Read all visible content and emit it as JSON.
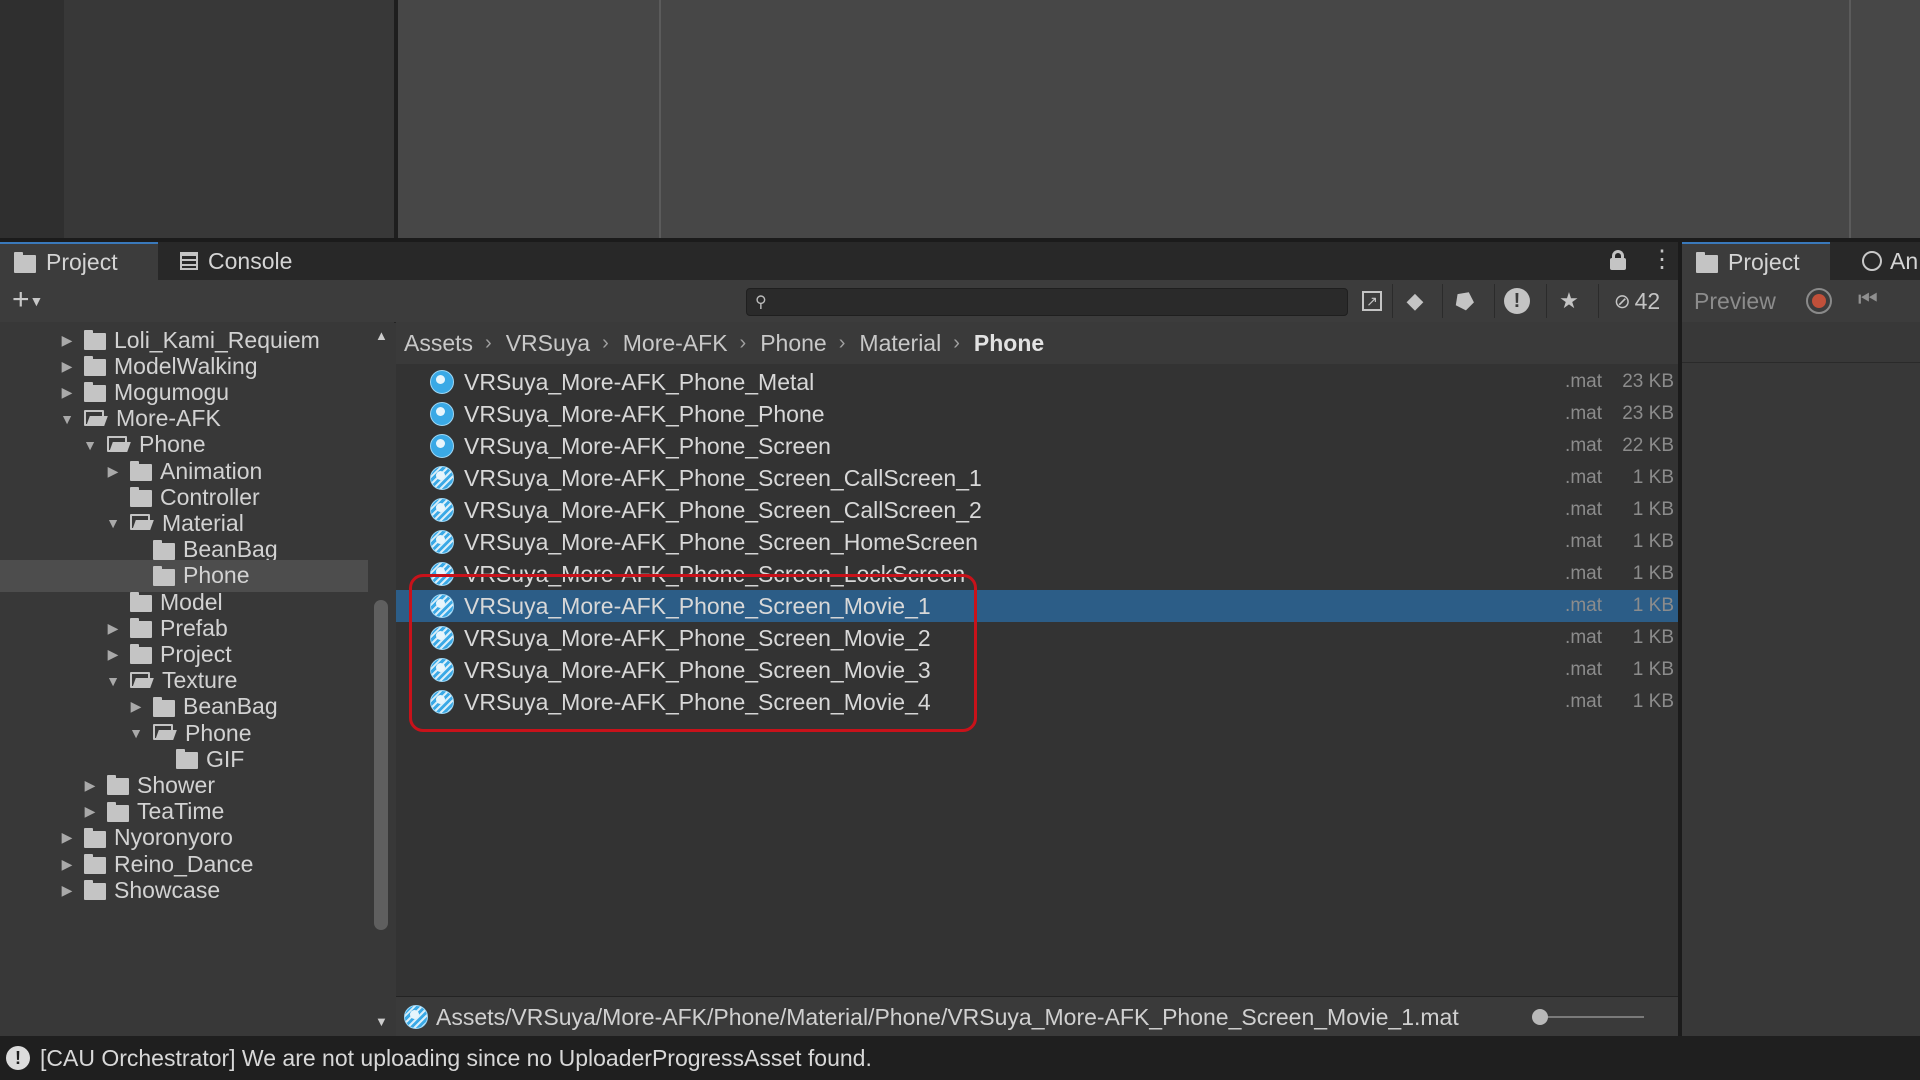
{
  "tabs": {
    "project": "Project",
    "console": "Console"
  },
  "toolbar": {
    "hidden_count": "42",
    "search_value": ""
  },
  "tree": {
    "items": [
      {
        "label": "Loli_Kami_Requiem",
        "depth": 1,
        "expanded": false,
        "has_children": true
      },
      {
        "label": "ModelWalking",
        "depth": 1,
        "expanded": false,
        "has_children": true
      },
      {
        "label": "Mogumogu",
        "depth": 1,
        "expanded": false,
        "has_children": true
      },
      {
        "label": "More-AFK",
        "depth": 1,
        "expanded": true,
        "has_children": true
      },
      {
        "label": "Phone",
        "depth": 2,
        "expanded": true,
        "has_children": true
      },
      {
        "label": "Animation",
        "depth": 3,
        "expanded": false,
        "has_children": true
      },
      {
        "label": "Controller",
        "depth": 3,
        "expanded": false,
        "has_children": false
      },
      {
        "label": "Material",
        "depth": 3,
        "expanded": true,
        "has_children": true
      },
      {
        "label": "BeanBag",
        "depth": 4,
        "expanded": false,
        "has_children": false
      },
      {
        "label": "Phone",
        "depth": 4,
        "expanded": false,
        "has_children": false,
        "selected": true
      },
      {
        "label": "Model",
        "depth": 3,
        "expanded": false,
        "has_children": false
      },
      {
        "label": "Prefab",
        "depth": 3,
        "expanded": false,
        "has_children": true
      },
      {
        "label": "Project",
        "depth": 3,
        "expanded": false,
        "has_children": true
      },
      {
        "label": "Texture",
        "depth": 3,
        "expanded": true,
        "has_children": true
      },
      {
        "label": "BeanBag",
        "depth": 4,
        "expanded": false,
        "has_children": true
      },
      {
        "label": "Phone",
        "depth": 4,
        "expanded": true,
        "has_children": true
      },
      {
        "label": "GIF",
        "depth": 5,
        "expanded": false,
        "has_children": false
      },
      {
        "label": "Shower",
        "depth": 2,
        "expanded": false,
        "has_children": true
      },
      {
        "label": "TeaTime",
        "depth": 2,
        "expanded": false,
        "has_children": true
      },
      {
        "label": "Nyoronyoro",
        "depth": 1,
        "expanded": false,
        "has_children": true
      },
      {
        "label": "Reino_Dance",
        "depth": 1,
        "expanded": false,
        "has_children": true
      },
      {
        "label": "Showcase",
        "depth": 1,
        "expanded": false,
        "has_children": true
      }
    ]
  },
  "breadcrumb": [
    "Assets",
    "VRSuya",
    "More-AFK",
    "Phone",
    "Material",
    "Phone"
  ],
  "files": [
    {
      "name": "VRSuya_More-AFK_Phone_Metal",
      "ext": ".mat",
      "size": "23 KB",
      "striped": false
    },
    {
      "name": "VRSuya_More-AFK_Phone_Phone",
      "ext": ".mat",
      "size": "23 KB",
      "striped": false
    },
    {
      "name": "VRSuya_More-AFK_Phone_Screen",
      "ext": ".mat",
      "size": "22 KB",
      "striped": false
    },
    {
      "name": "VRSuya_More-AFK_Phone_Screen_CallScreen_1",
      "ext": ".mat",
      "size": "1 KB",
      "striped": true
    },
    {
      "name": "VRSuya_More-AFK_Phone_Screen_CallScreen_2",
      "ext": ".mat",
      "size": "1 KB",
      "striped": true
    },
    {
      "name": "VRSuya_More-AFK_Phone_Screen_HomeScreen",
      "ext": ".mat",
      "size": "1 KB",
      "striped": true
    },
    {
      "name": "VRSuya_More-AFK_Phone_Screen_LockScreen",
      "ext": ".mat",
      "size": "1 KB",
      "striped": true
    },
    {
      "name": "VRSuya_More-AFK_Phone_Screen_Movie_1",
      "ext": ".mat",
      "size": "1 KB",
      "striped": true,
      "selected": true
    },
    {
      "name": "VRSuya_More-AFK_Phone_Screen_Movie_2",
      "ext": ".mat",
      "size": "1 KB",
      "striped": true
    },
    {
      "name": "VRSuya_More-AFK_Phone_Screen_Movie_3",
      "ext": ".mat",
      "size": "1 KB",
      "striped": true
    },
    {
      "name": "VRSuya_More-AFK_Phone_Screen_Movie_4",
      "ext": ".mat",
      "size": "1 KB",
      "striped": true
    }
  ],
  "path_bar": {
    "path": "Assets/VRSuya/More-AFK/Phone/Material/Phone/VRSuya_More-AFK_Phone_Screen_Movie_1.mat"
  },
  "right_panel": {
    "tab_project": "Project",
    "tab_animation": "An",
    "preview_label": "Preview"
  },
  "status": {
    "message": "[CAU Orchestrator] We are not uploading since no UploaderProgressAsset found."
  },
  "colors": {
    "selection": "#2c5d87",
    "highlight_box": "#c8121a",
    "material_icon": "#3aa9e6"
  }
}
